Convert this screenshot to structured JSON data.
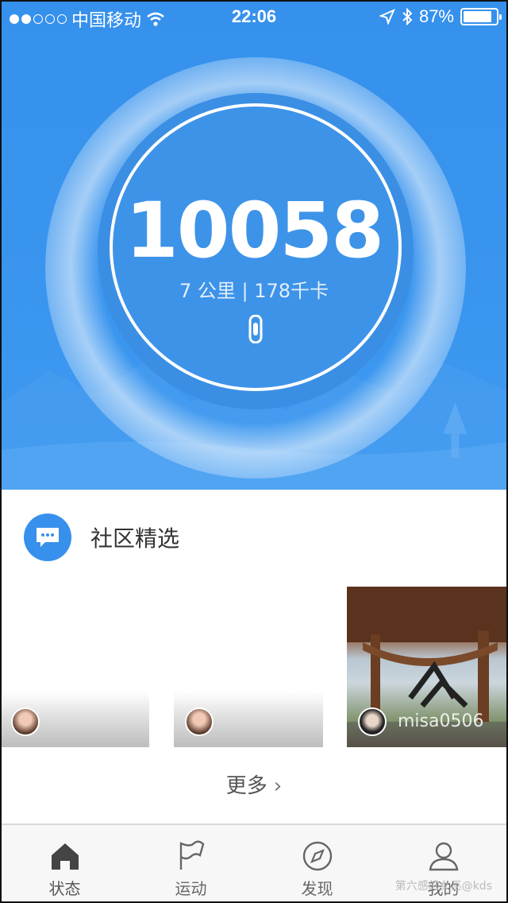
{
  "status_bar": {
    "carrier": "中国移动",
    "time": "22:06",
    "battery": "87%",
    "battery_level": 0.87
  },
  "hero": {
    "steps": "10058",
    "stats": "7 公里 | 178千卡",
    "accent": "#3790ec"
  },
  "community": {
    "title": "社区精选",
    "posts": [
      {
        "user": ""
      },
      {
        "user": ""
      },
      {
        "user": "misa0506"
      }
    ],
    "more_label": "更多"
  },
  "tabs": [
    {
      "label": "状态",
      "icon": "home-icon",
      "active": true
    },
    {
      "label": "运动",
      "icon": "flag-icon",
      "active": false
    },
    {
      "label": "发现",
      "icon": "compass-icon",
      "active": false
    },
    {
      "label": "我的",
      "icon": "person-icon",
      "active": false
    }
  ],
  "watermark": "第六感的女巫@kds"
}
